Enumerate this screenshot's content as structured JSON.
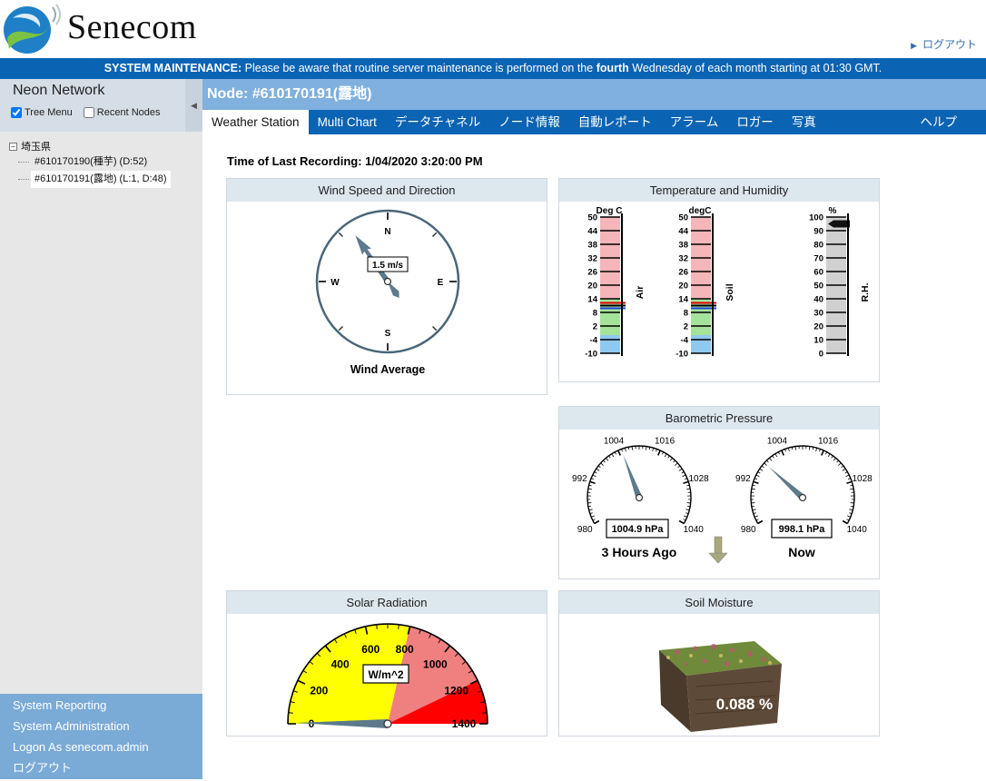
{
  "header": {
    "brand": "Senecom",
    "logout_label": "ログアウト"
  },
  "maintenance": {
    "prefix": "SYSTEM MAINTENANCE:",
    "text1": " Please be aware that routine server maintenance is performed on the ",
    "emph": "fourth",
    "text2": " Wednesday of each month starting at 01:30 GMT."
  },
  "sidebar": {
    "title": "Neon Network",
    "tree_menu_label": "Tree Menu",
    "tree_menu_checked": true,
    "recent_nodes_label": "Recent Nodes",
    "recent_nodes_checked": false,
    "tree": {
      "root": "埼玉県",
      "children": [
        "#610170190(種芋) (D:52)",
        "#610170191(露地) (L:1, D:48)"
      ]
    },
    "links": [
      "System Reporting",
      "System Administration",
      "Logon As senecom.admin",
      "ログアウト"
    ]
  },
  "node": {
    "title": "Node: #610170191(露地)"
  },
  "tabs": [
    "Weather Station",
    "Multi Chart",
    "データチャネル",
    "ノード情報",
    "自動レポート",
    "アラーム",
    "ロガー",
    "写真",
    "ヘルプ"
  ],
  "last_recording": "Time of Last Recording: 1/04/2020 3:20:00 PM",
  "wind": {
    "title": "Wind Speed and Direction",
    "speed_label": "1.5 m/s",
    "direction_deg": 325,
    "footer": "Wind Average",
    "cardinals": [
      "N",
      "E",
      "S",
      "W"
    ]
  },
  "temp": {
    "title": "Temperature and Humidity",
    "air_unit": "Deg C",
    "soil_unit": "degC",
    "rh_unit": "%",
    "air_label": "Air",
    "soil_label": "Soil",
    "rh_label": "R.H.",
    "ticks": [
      "50",
      "44",
      "38",
      "32",
      "26",
      "20",
      "14",
      "8",
      "2",
      "-4",
      "-10"
    ],
    "rh_ticks": [
      "100",
      "90",
      "80",
      "70",
      "60",
      "50",
      "40",
      "30",
      "20",
      "10",
      "0"
    ],
    "air_value": 11,
    "soil_value": 11,
    "rh_value": 95
  },
  "baro": {
    "title": "Barometric Pressure",
    "scale": [
      "980",
      "992",
      "1004",
      "1016",
      "1028",
      "1040"
    ],
    "past_value": 1004.9,
    "past_label": "1004.9 hPa",
    "past_caption": "3 Hours Ago",
    "now_value": 998.1,
    "now_label": "998.1 hPa",
    "now_caption": "Now"
  },
  "solar": {
    "title": "Solar Radiation",
    "scale": [
      "0",
      "200",
      "400",
      "600",
      "800",
      "1000",
      "1200",
      "1400"
    ],
    "unit_label": "W/m^2",
    "value": 0
  },
  "soil_moisture": {
    "title": "Soil Moisture",
    "value_label": "0.088 %"
  },
  "colors": {
    "brand_blue": "#0b63b3",
    "node_bar": "#7fb0de",
    "gauge_yellow": "#ffff00",
    "gauge_pink": "#f08080",
    "gauge_red": "#ff0000",
    "therm_red": "#f4b6b8",
    "therm_green": "#a6e39a",
    "therm_blue": "#8fc8f0"
  }
}
